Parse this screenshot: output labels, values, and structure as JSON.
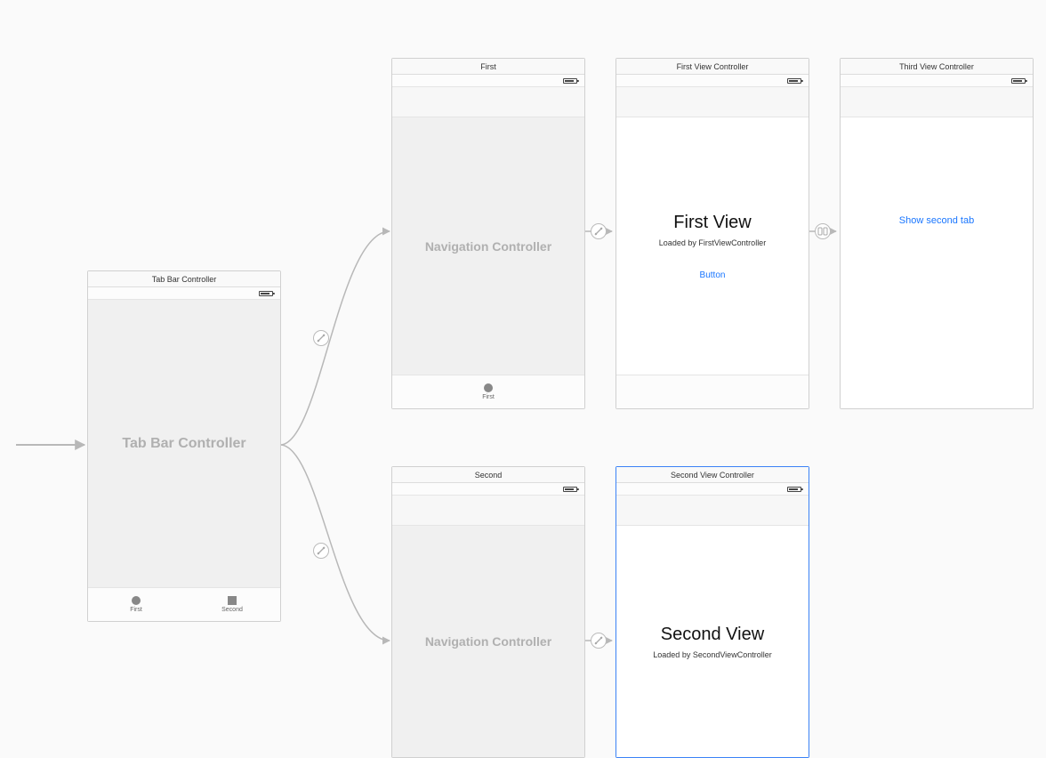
{
  "scenes": {
    "tabController": {
      "title": "Tab Bar Controller",
      "bodyLabel": "Tab Bar Controller",
      "tabs": [
        {
          "label": "First"
        },
        {
          "label": "Second"
        }
      ]
    },
    "nav1": {
      "title": "First",
      "bodyLabel": "Navigation Controller",
      "tabLabel": "First"
    },
    "nav2": {
      "title": "Second",
      "bodyLabel": "Navigation Controller"
    },
    "firstView": {
      "title": "First View Controller",
      "heading": "First View",
      "subtitle": "Loaded by FirstViewController",
      "buttonLabel": "Button"
    },
    "secondView": {
      "title": "Second View Controller",
      "heading": "Second View",
      "subtitle": "Loaded by SecondViewController"
    },
    "thirdView": {
      "title": "Third View Controller",
      "linkLabel": "Show second tab"
    }
  }
}
